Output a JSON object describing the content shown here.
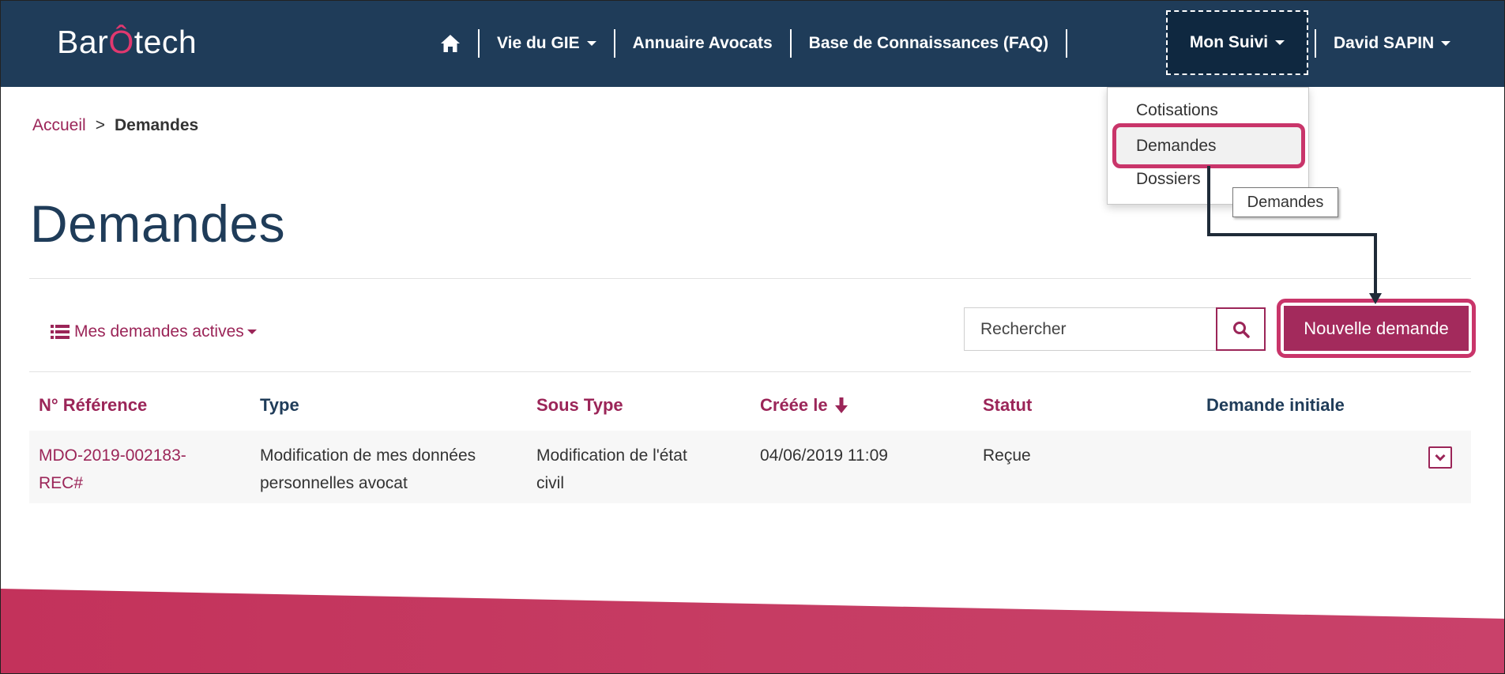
{
  "app": {
    "logo_part1": "Bar",
    "logo_part2": "Ô",
    "logo_part3": "tech",
    "brand_color": "#1f3c59",
    "accent_color": "#9b2558"
  },
  "nav": {
    "home_icon": "home-icon",
    "items": [
      {
        "label": "Vie du GIE"
      },
      {
        "label": "Annuaire Avocats"
      },
      {
        "label": "Base de Connaissances (FAQ)"
      },
      {
        "label": "Mon Suivi"
      },
      {
        "label": "David SAPIN"
      }
    ]
  },
  "dropdown": {
    "items": [
      {
        "label": "Cotisations"
      },
      {
        "label": "Demandes"
      },
      {
        "label": "Dossiers"
      }
    ],
    "tooltip": "Demandes"
  },
  "breadcrumb": {
    "home": "Accueil",
    "separator": ">",
    "current": "Demandes"
  },
  "page": {
    "title": "Demandes"
  },
  "toolbar": {
    "filter_label": "Mes demandes actives",
    "search_placeholder": "Rechercher",
    "new_button": "Nouvelle demande"
  },
  "table": {
    "columns": [
      "N° Référence",
      "Type",
      "Sous Type",
      "Créée le",
      "Statut",
      "Demande initiale"
    ],
    "rows": [
      {
        "reference_line1": "MDO-2019-002183-",
        "reference_line2": "REC#",
        "type_line1": "Modification de mes données",
        "type_line2": "personnelles avocat",
        "subtype_line1": "Modification de l'état",
        "subtype_line2": "civil",
        "created": "04/06/2019 11:09",
        "status": "Reçue",
        "initial": ""
      }
    ]
  },
  "footer": {
    "color": "#c63a62"
  }
}
